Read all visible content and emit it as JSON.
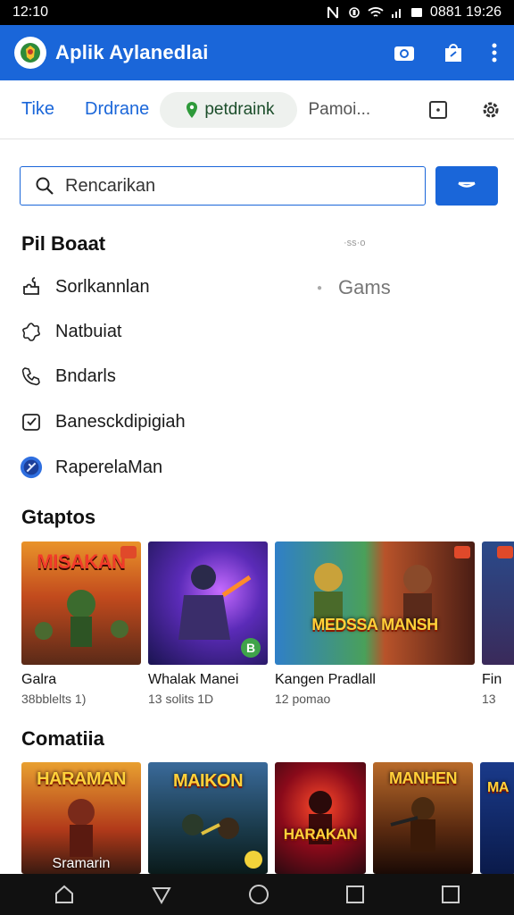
{
  "status_bar": {
    "time": "12:10",
    "right_text": "0881 19:26"
  },
  "app_bar": {
    "title": "Aplik Aylanedlai"
  },
  "tabs": [
    {
      "label": "Tike"
    },
    {
      "label": "Drdrane"
    },
    {
      "label": "petdraink"
    },
    {
      "label": "Pamoi..."
    }
  ],
  "search": {
    "placeholder": "Rencarikan"
  },
  "section1": {
    "title": "Pil Boaat",
    "tiny_label": "·ss·o",
    "items": [
      {
        "label": "Sorlkannlan",
        "icon": "puzzle-icon"
      },
      {
        "label": "Natbuiat",
        "icon": "gear-puzzle-icon"
      },
      {
        "label": "Bndarls",
        "icon": "phone-icon"
      },
      {
        "label": "Banesckdipigiah",
        "icon": "check-square-icon"
      },
      {
        "label": "RaperelaMan",
        "icon": "app-avatar-icon"
      }
    ],
    "side_label": "Gams"
  },
  "section2": {
    "title": "Gtaptos",
    "cards": [
      {
        "art_text": "MISAKAN",
        "name": "Galra",
        "sub": "38bblelts 1)"
      },
      {
        "art_text": "",
        "name": "Whalak Manei",
        "sub": "13 solits 1D"
      },
      {
        "art_text": "MEDSSA  MANSH",
        "name": "Kangen Pradlall",
        "sub": "12 pomao"
      },
      {
        "art_text": "",
        "name": "Fin",
        "sub": "13"
      }
    ]
  },
  "section3": {
    "title": "Comatiia",
    "cards": [
      {
        "art_text": "HARAMAN",
        "caption": "Sramarin"
      },
      {
        "art_text": "MAIKON"
      },
      {
        "art_text": "HARAKAN"
      },
      {
        "art_text": "MANHEN"
      },
      {
        "art_text": "MA"
      }
    ]
  },
  "colors": {
    "primary": "#1a66d9",
    "pill_bg": "#eef1ee",
    "nav": "#111111"
  }
}
